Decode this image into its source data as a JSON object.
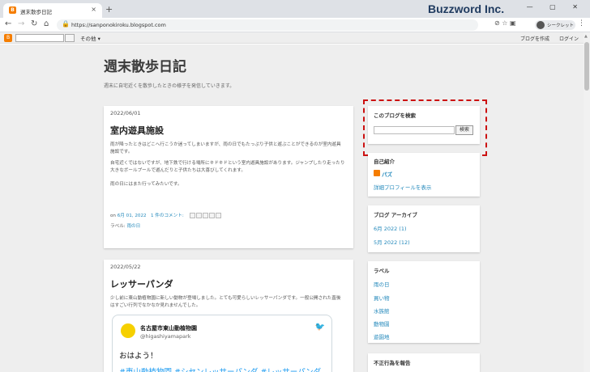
{
  "browser": {
    "tab_title": "週末散歩日記",
    "favicon_letter": "B",
    "tab_close": "×",
    "new_tab": "+",
    "url": "https://sanponokiroku.blogspot.com",
    "profile_label": "シークレット",
    "watermark": "Buzzword Inc.",
    "window_controls": "— ▢ ✕"
  },
  "navbar": {
    "more_label": "その他",
    "create_blog": "ブログを作成",
    "login": "ログイン"
  },
  "blog": {
    "title": "週末散歩日記",
    "description": "週末に自宅近くを散歩したときの様子を発信していきます。"
  },
  "posts": [
    {
      "date": "2022/06/01",
      "title": "室内遊具施設",
      "p1": "雨が降ったときはどこへ行こうか迷ってしまいますが、雨の日でもたっぷり子供と遊ぶことができるのが室内遊具施設です。",
      "p2": "自宅近くではないですが、地下鉄で行ける場所にキドキドという室内遊具施設があります。ジャンプしたり走ったり大きなボールプールで遊んだりと子供たちは大喜びしてくれます。",
      "p3": "雨の日にはまた行ってみたいです。",
      "footer_on": "on",
      "footer_date": "6月 01, 2022",
      "footer_comments": "1 件のコメント:",
      "label_prefix": "ラベル:",
      "label": "雨の日"
    },
    {
      "date": "2022/05/22",
      "title": "レッサーパンダ",
      "p1": "少し前に東山動植物園に新しい動物が登場しました。とても可愛らしいレッサーパンダです。一般公開された直後はすごい行列でなかなか見れませんでした。",
      "tweet": {
        "name": "名古屋市東山動植物園",
        "handle": "@higashiyamapark",
        "body": "おはよう！",
        "tags": "#東山動植物園 #シセンレッサーパンダ #レッサーパンダ"
      }
    }
  ],
  "sidebar": {
    "search": {
      "title": "このブログを検索",
      "button": "検索"
    },
    "profile": {
      "title": "自己紹介",
      "name": "パズ",
      "details": "詳細プロフィールを表示"
    },
    "archive": {
      "title": "ブログ アーカイブ",
      "items": [
        "6月 2022 (1)",
        "5月 2022 (12)"
      ]
    },
    "labels": {
      "title": "ラベル",
      "items": [
        "雨の日",
        "買い物",
        "水族館",
        "動物園",
        "遊園地"
      ]
    },
    "report": {
      "title": "不正行為を報告"
    }
  },
  "colors": {
    "highlight": "#cc1111",
    "link": "#2288bb",
    "blogger_orange": "#f57d00"
  }
}
